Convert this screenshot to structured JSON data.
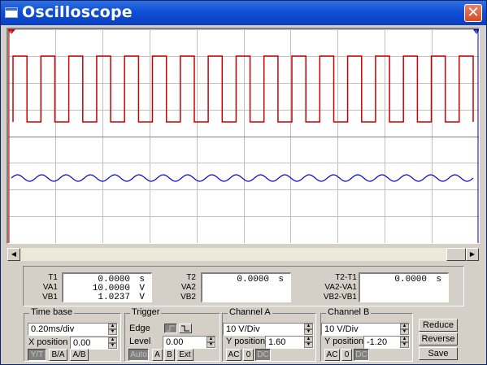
{
  "window": {
    "title": "Oscilloscope",
    "close_glyph": "✕",
    "icon": "window-icon"
  },
  "scope": {
    "marker1": "1",
    "marker2": "2",
    "channel_a_color": "#cc0000",
    "channel_b_color": "#0000cc",
    "grid_color": "#c0c0c0",
    "grid_center_color": "#808080",
    "channel_a_periods_visible": 16.5,
    "channel_b_periods_visible": 19
  },
  "readouts": {
    "t1": {
      "label": "T1",
      "value": "0.0000",
      "unit": "s"
    },
    "va1": {
      "label": "VA1",
      "value": "10.0000",
      "unit": "V"
    },
    "vb1": {
      "label": "VB1",
      "value": "1.0237",
      "unit": "V"
    },
    "t2": {
      "label": "T2",
      "value": "0.0000",
      "unit": "s"
    },
    "va2": {
      "label": "VA2"
    },
    "vb2": {
      "label": "VB2"
    },
    "t21": {
      "label": "T2-T1",
      "value": "0.0000",
      "unit": "s"
    },
    "va21": {
      "label": "VA2-VA1"
    },
    "vb21": {
      "label": "VB2-VB1"
    }
  },
  "timebase": {
    "legend": "Time base",
    "scale": "0.20ms/div",
    "xpos_label": "X position",
    "xpos": "0.00",
    "modes": [
      "Y/T",
      "B/A",
      "A/B"
    ],
    "active_mode": "Y/T"
  },
  "trigger": {
    "legend": "Trigger",
    "edge_label": "Edge",
    "level_label": "Level",
    "level": "0.00",
    "sources": [
      "Auto",
      "A",
      "B",
      "Ext"
    ],
    "active_source": "Auto"
  },
  "channel_a": {
    "legend": "Channel A",
    "scale": "10 V/Div",
    "ypos_label": "Y position",
    "ypos": "1.60",
    "coupling": [
      "AC",
      "0",
      "DC"
    ],
    "active": "DC"
  },
  "channel_b": {
    "legend": "Channel B",
    "scale": "10 V/Div",
    "ypos_label": "Y position",
    "ypos": "-1.20",
    "coupling": [
      "AC",
      "0",
      "DC"
    ],
    "active": "DC"
  },
  "actions": {
    "reduce": "Reduce",
    "reverse": "Reverse",
    "save": "Save"
  }
}
